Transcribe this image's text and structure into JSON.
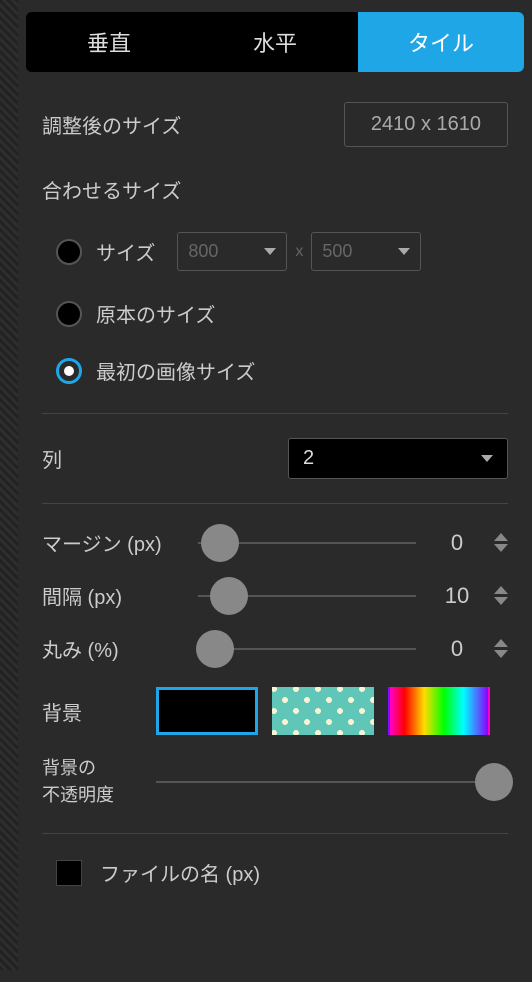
{
  "tabs": {
    "vertical": "垂直",
    "horizontal": "水平",
    "tile": "タイル"
  },
  "adjusted_size": {
    "label": "調整後のサイズ",
    "value": "2410 x 1610"
  },
  "fit_size": {
    "label": "合わせるサイズ",
    "options": {
      "custom": {
        "label": "サイズ",
        "width": "800",
        "height": "500",
        "separator": "x"
      },
      "original": {
        "label": "原本のサイズ"
      },
      "first_image": {
        "label": "最初の画像サイズ"
      }
    },
    "selected": "first_image"
  },
  "columns": {
    "label": "列",
    "value": "2"
  },
  "margin": {
    "label": "マージン (px)",
    "value": "0",
    "pos": 0
  },
  "spacing": {
    "label": "間隔 (px)",
    "value": "10",
    "pos": 10
  },
  "rounding": {
    "label": "丸み (%)",
    "value": "0",
    "pos": 0
  },
  "background": {
    "label": "背景"
  },
  "bg_opacity": {
    "label_line1": "背景の",
    "label_line2": "不透明度",
    "pos": 100
  },
  "filename": {
    "label": "ファイルの名 (px)"
  }
}
